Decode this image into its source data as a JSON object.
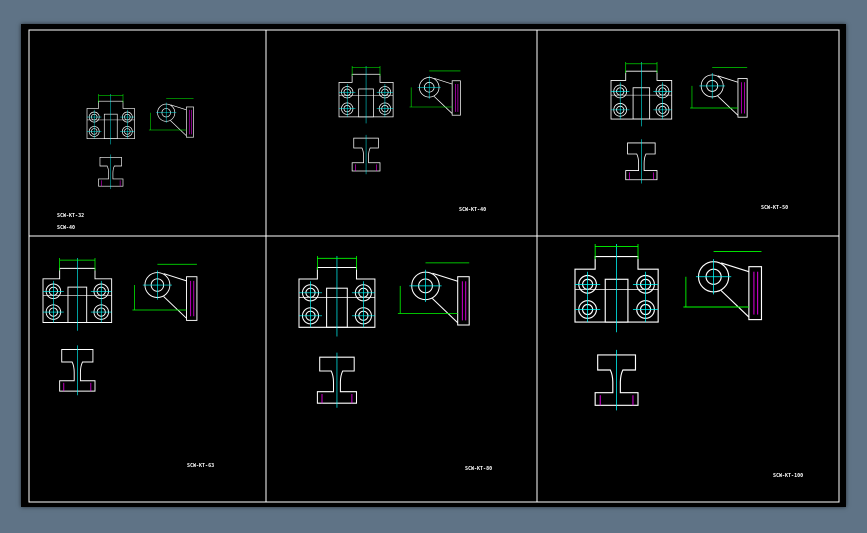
{
  "drawing": {
    "background": "#000000",
    "line_white": "#ffffff",
    "line_green": "#00ff00",
    "line_cyan": "#00ffff",
    "line_magenta": "#ff00ff"
  },
  "panels": [
    {
      "id": "p1",
      "label_lines": [
        "SCW-KT-32",
        "SCW-40"
      ]
    },
    {
      "id": "p2",
      "label_lines": [
        "SCW-KT-40"
      ]
    },
    {
      "id": "p3",
      "label_lines": [
        "SCW-KT-50"
      ]
    },
    {
      "id": "p4",
      "label_lines": [
        "SCW-KT-63"
      ]
    },
    {
      "id": "p5",
      "label_lines": [
        "SCW-KT-80"
      ]
    },
    {
      "id": "p6",
      "label_lines": [
        "SCW-KT-100"
      ]
    }
  ]
}
